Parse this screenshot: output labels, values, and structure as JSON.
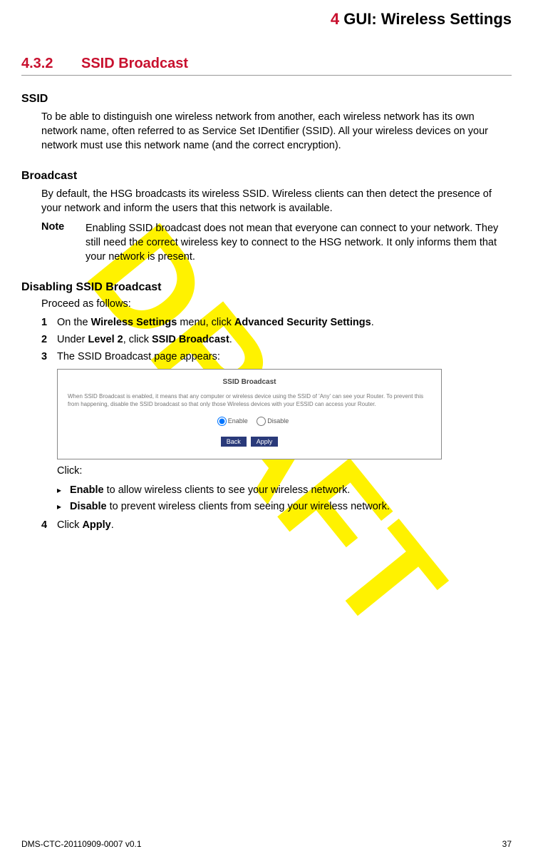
{
  "header": {
    "num": "4",
    "title": "GUI: Wireless Settings"
  },
  "watermark": "DRAFT",
  "section": {
    "num": "4.3.2",
    "title": "SSID Broadcast"
  },
  "ssid": {
    "heading": "SSID",
    "text": "To be able to distinguish one wireless network from another, each wireless network has its own network name, often referred to as Service Set IDentifier (SSID). All your wireless devices on your network must use this network name (and the correct encryption)."
  },
  "broadcast": {
    "heading": "Broadcast",
    "text": "By default, the HSG broadcasts its wireless SSID. Wireless clients can then detect the presence of your network and inform the users that this network is available.",
    "note_label": "Note",
    "note_text": "Enabling SSID broadcast does not mean that everyone can connect to your network. They still need the correct wireless key to connect to the HSG network. It only informs them that your network is present."
  },
  "disable": {
    "heading": "Disabling SSID Broadcast",
    "proceed": "Proceed as follows:",
    "step1_a": "On the ",
    "step1_b": "Wireless Settings",
    "step1_c": " menu, click ",
    "step1_d": "Advanced Security Settings",
    "step1_e": ".",
    "step2_a": "Under ",
    "step2_b": "Level 2",
    "step2_c": ", click ",
    "step2_d": "SSID Broadcast",
    "step2_e": ".",
    "step3": "The SSID Broadcast page appears:",
    "dialog": {
      "title": "SSID Broadcast",
      "desc": "When SSID Broadcast is enabled, it means that any computer or wireless device using the SSID of 'Any' can see your Router. To prevent this from happening, disable the SSID broadcast so that only those Wireless devices with your ESSID can access your Router.",
      "opt_enable": "Enable",
      "opt_disable": "Disable",
      "btn_back": "Back",
      "btn_apply": "Apply"
    },
    "click_label": "Click:",
    "bullet_enable_b": "Enable",
    "bullet_enable_t": " to allow wireless clients to see your wireless network.",
    "bullet_disable_b": "Disable",
    "bullet_disable_t": " to prevent wireless clients from seeing your wireless network.",
    "step4_a": "Click ",
    "step4_b": "Apply",
    "step4_c": "."
  },
  "footer": {
    "left": "DMS-CTC-20110909-0007 v0.1",
    "right": "37"
  }
}
